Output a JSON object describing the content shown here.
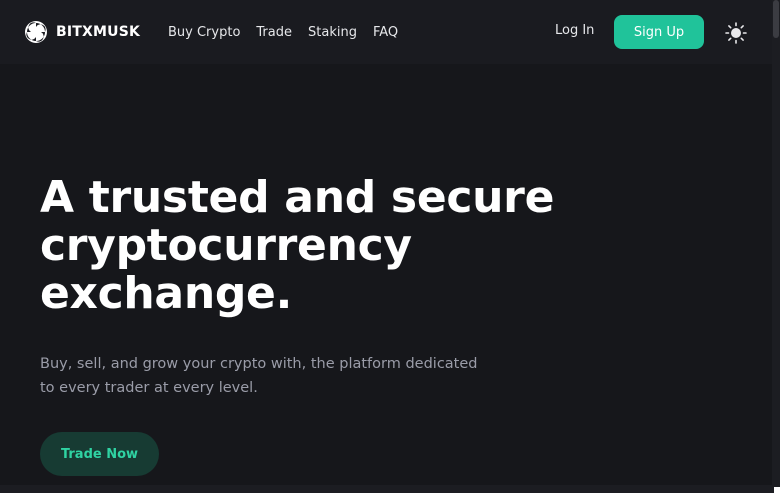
{
  "brand": {
    "name": "BITXMUSK",
    "logo_icon": "swirl-logo-icon"
  },
  "nav": {
    "items": [
      {
        "label": "Buy Crypto"
      },
      {
        "label": "Trade"
      },
      {
        "label": "Staking"
      },
      {
        "label": "FAQ"
      }
    ]
  },
  "auth": {
    "login_label": "Log In",
    "signup_label": "Sign Up"
  },
  "theme_toggle": {
    "icon": "sun-icon"
  },
  "hero": {
    "title_lines": [
      "A trusted and secure",
      "cryptocurrency",
      "exchange."
    ],
    "subtitle": "Buy, sell, and grow your crypto with, the platform dedicated to every trader at every level.",
    "cta_label": "Trade Now"
  },
  "colors": {
    "background": "#16171b",
    "header": "#1a1b20",
    "accent": "#20c39a",
    "cta_background": "#173b33",
    "cta_text": "#2fd3a3",
    "subtitle_text": "#9a9ca8"
  }
}
